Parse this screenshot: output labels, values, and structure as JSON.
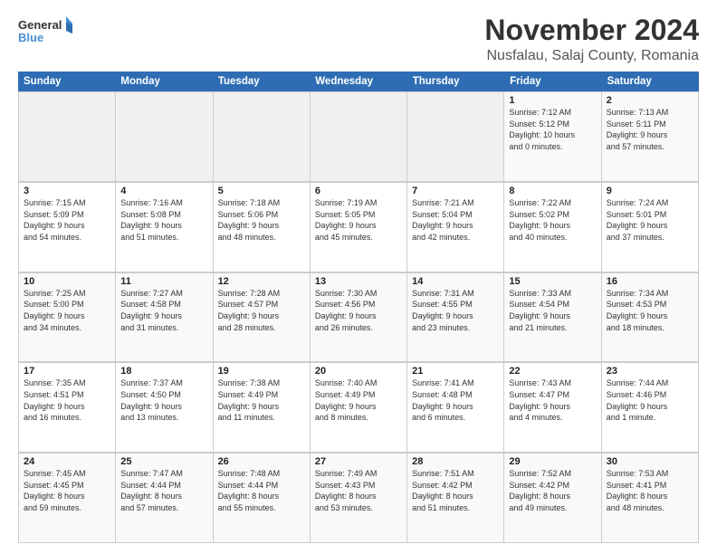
{
  "logo": {
    "line1": "General",
    "line2": "Blue"
  },
  "title": "November 2024",
  "subtitle": "Nusfalau, Salaj County, Romania",
  "header_days": [
    "Sunday",
    "Monday",
    "Tuesday",
    "Wednesday",
    "Thursday",
    "Friday",
    "Saturday"
  ],
  "weeks": [
    [
      {
        "day": "",
        "info": ""
      },
      {
        "day": "",
        "info": ""
      },
      {
        "day": "",
        "info": ""
      },
      {
        "day": "",
        "info": ""
      },
      {
        "day": "",
        "info": ""
      },
      {
        "day": "1",
        "info": "Sunrise: 7:12 AM\nSunset: 5:12 PM\nDaylight: 10 hours\nand 0 minutes."
      },
      {
        "day": "2",
        "info": "Sunrise: 7:13 AM\nSunset: 5:11 PM\nDaylight: 9 hours\nand 57 minutes."
      }
    ],
    [
      {
        "day": "3",
        "info": "Sunrise: 7:15 AM\nSunset: 5:09 PM\nDaylight: 9 hours\nand 54 minutes."
      },
      {
        "day": "4",
        "info": "Sunrise: 7:16 AM\nSunset: 5:08 PM\nDaylight: 9 hours\nand 51 minutes."
      },
      {
        "day": "5",
        "info": "Sunrise: 7:18 AM\nSunset: 5:06 PM\nDaylight: 9 hours\nand 48 minutes."
      },
      {
        "day": "6",
        "info": "Sunrise: 7:19 AM\nSunset: 5:05 PM\nDaylight: 9 hours\nand 45 minutes."
      },
      {
        "day": "7",
        "info": "Sunrise: 7:21 AM\nSunset: 5:04 PM\nDaylight: 9 hours\nand 42 minutes."
      },
      {
        "day": "8",
        "info": "Sunrise: 7:22 AM\nSunset: 5:02 PM\nDaylight: 9 hours\nand 40 minutes."
      },
      {
        "day": "9",
        "info": "Sunrise: 7:24 AM\nSunset: 5:01 PM\nDaylight: 9 hours\nand 37 minutes."
      }
    ],
    [
      {
        "day": "10",
        "info": "Sunrise: 7:25 AM\nSunset: 5:00 PM\nDaylight: 9 hours\nand 34 minutes."
      },
      {
        "day": "11",
        "info": "Sunrise: 7:27 AM\nSunset: 4:58 PM\nDaylight: 9 hours\nand 31 minutes."
      },
      {
        "day": "12",
        "info": "Sunrise: 7:28 AM\nSunset: 4:57 PM\nDaylight: 9 hours\nand 28 minutes."
      },
      {
        "day": "13",
        "info": "Sunrise: 7:30 AM\nSunset: 4:56 PM\nDaylight: 9 hours\nand 26 minutes."
      },
      {
        "day": "14",
        "info": "Sunrise: 7:31 AM\nSunset: 4:55 PM\nDaylight: 9 hours\nand 23 minutes."
      },
      {
        "day": "15",
        "info": "Sunrise: 7:33 AM\nSunset: 4:54 PM\nDaylight: 9 hours\nand 21 minutes."
      },
      {
        "day": "16",
        "info": "Sunrise: 7:34 AM\nSunset: 4:53 PM\nDaylight: 9 hours\nand 18 minutes."
      }
    ],
    [
      {
        "day": "17",
        "info": "Sunrise: 7:35 AM\nSunset: 4:51 PM\nDaylight: 9 hours\nand 16 minutes."
      },
      {
        "day": "18",
        "info": "Sunrise: 7:37 AM\nSunset: 4:50 PM\nDaylight: 9 hours\nand 13 minutes."
      },
      {
        "day": "19",
        "info": "Sunrise: 7:38 AM\nSunset: 4:49 PM\nDaylight: 9 hours\nand 11 minutes."
      },
      {
        "day": "20",
        "info": "Sunrise: 7:40 AM\nSunset: 4:49 PM\nDaylight: 9 hours\nand 8 minutes."
      },
      {
        "day": "21",
        "info": "Sunrise: 7:41 AM\nSunset: 4:48 PM\nDaylight: 9 hours\nand 6 minutes."
      },
      {
        "day": "22",
        "info": "Sunrise: 7:43 AM\nSunset: 4:47 PM\nDaylight: 9 hours\nand 4 minutes."
      },
      {
        "day": "23",
        "info": "Sunrise: 7:44 AM\nSunset: 4:46 PM\nDaylight: 9 hours\nand 1 minute."
      }
    ],
    [
      {
        "day": "24",
        "info": "Sunrise: 7:45 AM\nSunset: 4:45 PM\nDaylight: 8 hours\nand 59 minutes."
      },
      {
        "day": "25",
        "info": "Sunrise: 7:47 AM\nSunset: 4:44 PM\nDaylight: 8 hours\nand 57 minutes."
      },
      {
        "day": "26",
        "info": "Sunrise: 7:48 AM\nSunset: 4:44 PM\nDaylight: 8 hours\nand 55 minutes."
      },
      {
        "day": "27",
        "info": "Sunrise: 7:49 AM\nSunset: 4:43 PM\nDaylight: 8 hours\nand 53 minutes."
      },
      {
        "day": "28",
        "info": "Sunrise: 7:51 AM\nSunset: 4:42 PM\nDaylight: 8 hours\nand 51 minutes."
      },
      {
        "day": "29",
        "info": "Sunrise: 7:52 AM\nSunset: 4:42 PM\nDaylight: 8 hours\nand 49 minutes."
      },
      {
        "day": "30",
        "info": "Sunrise: 7:53 AM\nSunset: 4:41 PM\nDaylight: 8 hours\nand 48 minutes."
      }
    ]
  ]
}
